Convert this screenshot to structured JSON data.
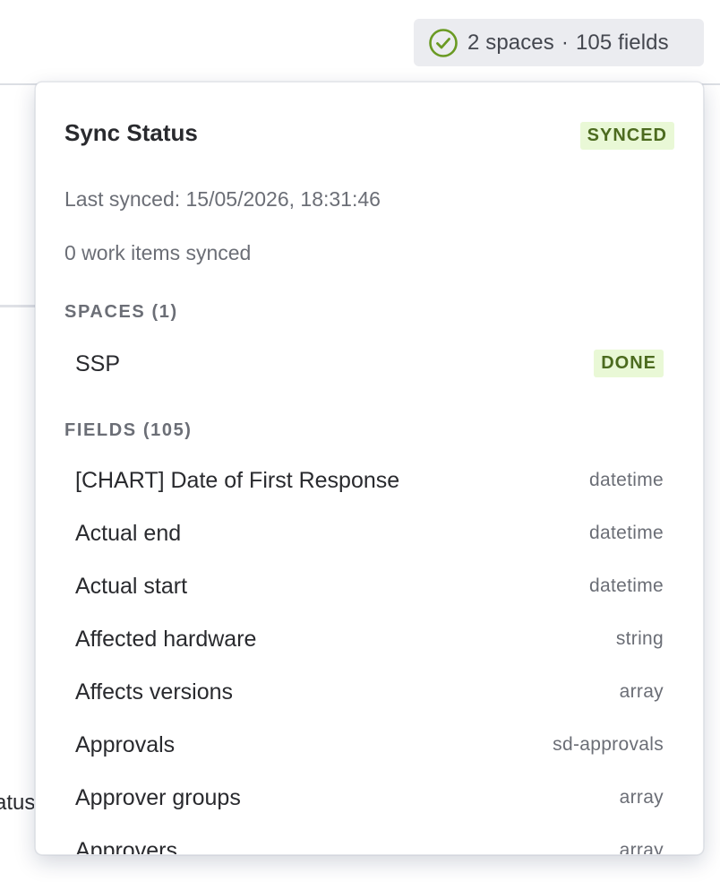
{
  "trigger": {
    "label": "2 spaces · 105 fields",
    "spaces_text": "2 spaces",
    "separator": "·",
    "fields_text": "105 fields",
    "icon": "check-circle-icon",
    "icon_color": "#6a9a23"
  },
  "background": {
    "partial_text": "atus"
  },
  "popover": {
    "title": "Sync Status",
    "status_badge": "SYNCED",
    "last_synced": "Last synced: 15/05/2026, 18:31:46",
    "work_items": "0 work items synced",
    "spaces_heading": "SPACES (1)",
    "fields_heading": "FIELDS (105)",
    "badge_bg": "#e9f8d6",
    "badge_fg": "#4c6b1f"
  },
  "spaces": [
    {
      "name": "SSP",
      "status": "DONE"
    }
  ],
  "fields": [
    {
      "name": "[CHART] Date of First Response",
      "type": "datetime"
    },
    {
      "name": "Actual end",
      "type": "datetime"
    },
    {
      "name": "Actual start",
      "type": "datetime"
    },
    {
      "name": "Affected hardware",
      "type": "string"
    },
    {
      "name": "Affects versions",
      "type": "array"
    },
    {
      "name": "Approvals",
      "type": "sd-approvals"
    },
    {
      "name": "Approver groups",
      "type": "array"
    },
    {
      "name": "Approvers",
      "type": "array"
    }
  ]
}
